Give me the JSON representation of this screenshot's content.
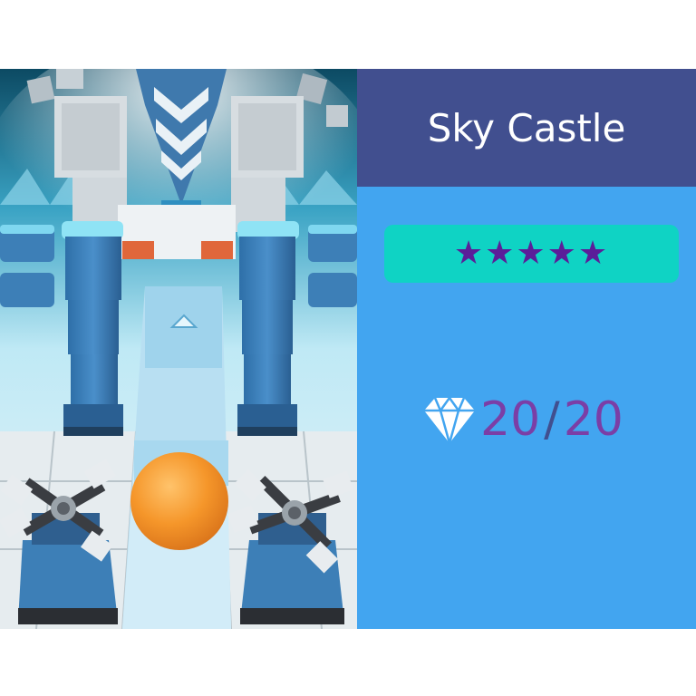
{
  "level": {
    "title": "Sky Castle",
    "stars": "★★★★★",
    "rating": {
      "value": 5,
      "max": 5
    },
    "gems": {
      "collected": "20",
      "separator": "/",
      "total": "20"
    }
  },
  "icons": {
    "gem": "diamond-icon",
    "star": "star-icon"
  },
  "colors": {
    "title_bg": "#414f8f",
    "panel_bg": "#42a5f0",
    "rating_bg": "#0fd3c4",
    "star": "#5b1e99",
    "gem_text": "#7b3ea6"
  }
}
